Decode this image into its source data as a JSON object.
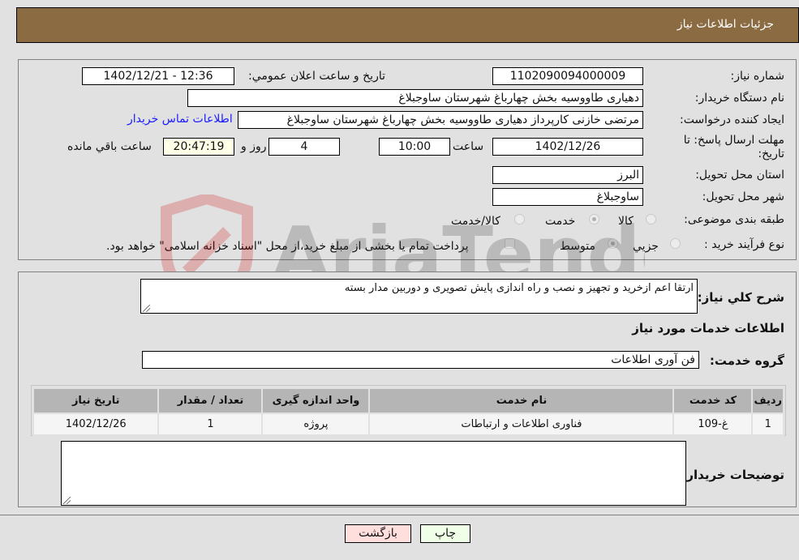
{
  "header": {
    "title": "جزئیات اطلاعات نیاز"
  },
  "fields": {
    "need_number": {
      "label": "شماره نیاز:",
      "value": "1102090094000009"
    },
    "announce_datetime": {
      "label": "تاریخ و ساعت اعلان عمومي:",
      "value": "1402/12/21 - 12:36"
    },
    "buyer_org": {
      "label": "نام دستگاه خریدار:",
      "value": "دهیاری طاووسیه بخش چهارباغ شهرستان ساوجبلاغ"
    },
    "requester": {
      "label": "ایجاد کننده درخواست:",
      "value": "مرتضی خازنی کارپرداز دهیاری طاووسیه بخش چهارباغ شهرستان ساوجبلاغ"
    },
    "buyer_contact_link": "اطلاعات تماس خریدار",
    "deadline": {
      "label": "مهلت ارسال پاسخ: تا تاریخ:",
      "date": "1402/12/26",
      "time_label": "ساعت",
      "time": "10:00",
      "days": "4",
      "days_label": "روز و",
      "remaining": "20:47:19",
      "remaining_label": "ساعت باقي مانده"
    },
    "province": {
      "label": "استان محل تحویل:",
      "value": "البرز"
    },
    "city": {
      "label": "شهر محل تحویل:",
      "value": "ساوجبلاغ"
    },
    "category": {
      "label": "طبقه بندی موضوعی:",
      "options": [
        "کالا",
        "خدمت",
        "کالا/خدمت"
      ],
      "selected": "خدمت"
    },
    "purchase_type": {
      "label": "نوع فرآیند خرید :",
      "options": [
        "جزيي",
        "متوسط"
      ],
      "selected": "متوسط",
      "treasury_note": "پرداخت تمام یا بخشی از مبلغ خرید،از محل \"اسناد خزانه اسلامی\" خواهد بود."
    }
  },
  "details": {
    "description_label": "شرح کلي نیاز:",
    "description": "ارتقا اعم ازخرید و تجهیز  و نصب و راه اندازی پایش تصویری و دوربین مدار بسته",
    "services_heading": "اطلاعات خدمات مورد نیاز",
    "service_group_label": "گروه خدمت:",
    "service_group": "فن آوری اطلاعات",
    "table": {
      "headers": [
        "ردیف",
        "کد خدمت",
        "نام خدمت",
        "واحد اندازه گیری",
        "تعداد / مقدار",
        "تاریخ نیاز"
      ],
      "rows": [
        [
          "1",
          "غ-109",
          "فناوری اطلاعات و ارتباطات",
          "پروژه",
          "1",
          "1402/12/26"
        ]
      ]
    },
    "buyer_notes_label": "توضیحات خریدار:",
    "buyer_notes": ""
  },
  "buttons": {
    "print": "چاپ",
    "back": "بازگشت"
  },
  "watermark": "AriaTender.neT"
}
